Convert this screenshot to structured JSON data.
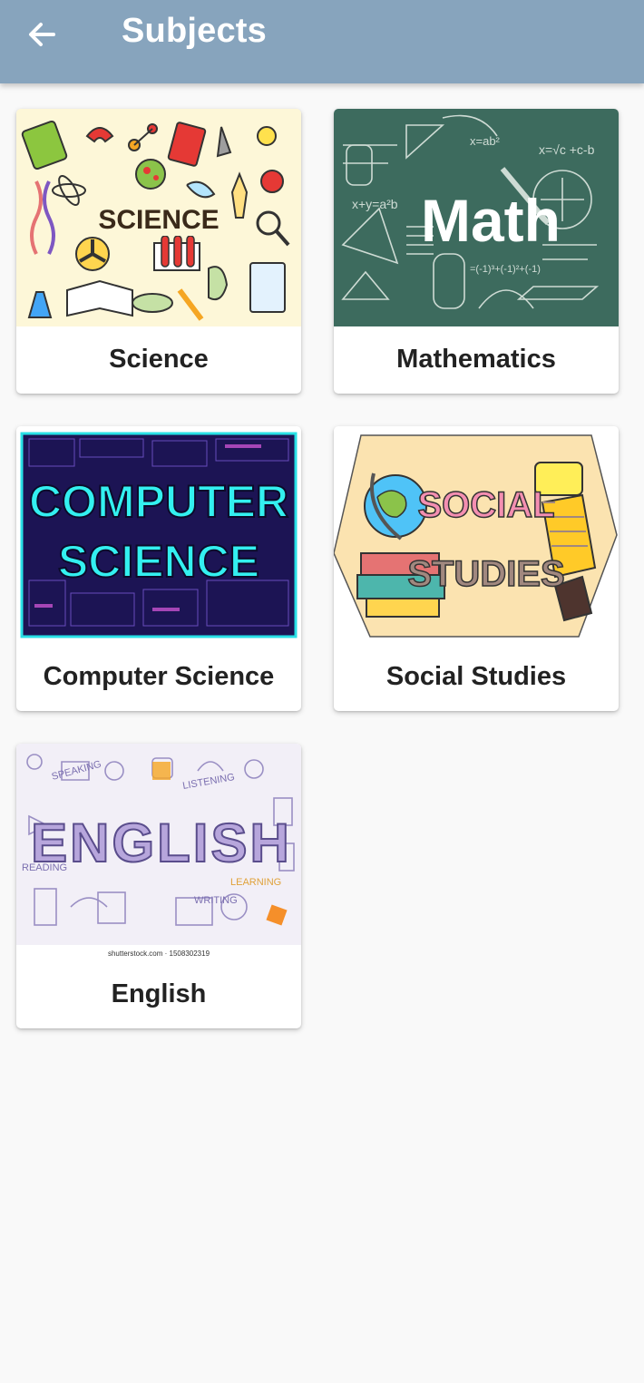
{
  "app_bar": {
    "title": "Subjects",
    "back_icon": "arrow-left-icon",
    "background": "#87a4bd"
  },
  "subjects": [
    {
      "label": "Science",
      "image_text": "SCIENCE"
    },
    {
      "label": "Mathematics",
      "image_text": "Math"
    },
    {
      "label": "Computer Science",
      "image_text_line1": "COMPUTER",
      "image_text_line2": "SCIENCE"
    },
    {
      "label": "Social Studies",
      "image_text_line1": "SOCIAL",
      "image_text_line2": "STUDIES"
    },
    {
      "label": "English",
      "image_text": "ENGLISH",
      "image_caption": "shutterstock.com · 1508302319"
    }
  ]
}
